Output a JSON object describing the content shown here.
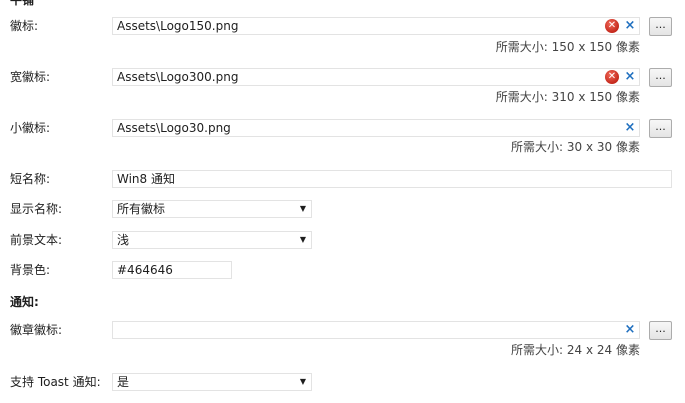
{
  "sections": {
    "tile": "平铺",
    "notifications": "通知:"
  },
  "fields": {
    "logo": {
      "label": "徽标:",
      "value": "Assets\\Logo150.png",
      "hint": "所需大小: 150 x 150 像素",
      "browse": "..."
    },
    "wide_logo": {
      "label": "宽徽标:",
      "value": "Assets\\Logo300.png",
      "hint": "所需大小: 310 x 150 像素",
      "browse": "..."
    },
    "small_logo": {
      "label": "小徽标:",
      "value": "Assets\\Logo30.png",
      "hint": "所需大小: 30 x 30 像素",
      "browse": "..."
    },
    "short_name": {
      "label": "短名称:",
      "value": "Win8 通知"
    },
    "show_name": {
      "label": "显示名称:",
      "value": "所有徽标"
    },
    "foreground_text": {
      "label": "前景文本:",
      "value": "浅"
    },
    "background_color": {
      "label": "背景色:",
      "value": "#464646"
    },
    "badge_logo": {
      "label": "徽章徽标:",
      "value": "",
      "hint": "所需大小: 24 x 24 像素",
      "browse": "..."
    },
    "toast": {
      "label": "支持 Toast 通知:",
      "value": "是"
    }
  },
  "icons": {
    "error": "error-circle-icon",
    "clear": "clear-x-icon",
    "dropdown": "chevron-down-icon"
  },
  "colors": {
    "error": "#c4281c",
    "clear": "#1f6fbf",
    "border": "#e3e3e3"
  }
}
